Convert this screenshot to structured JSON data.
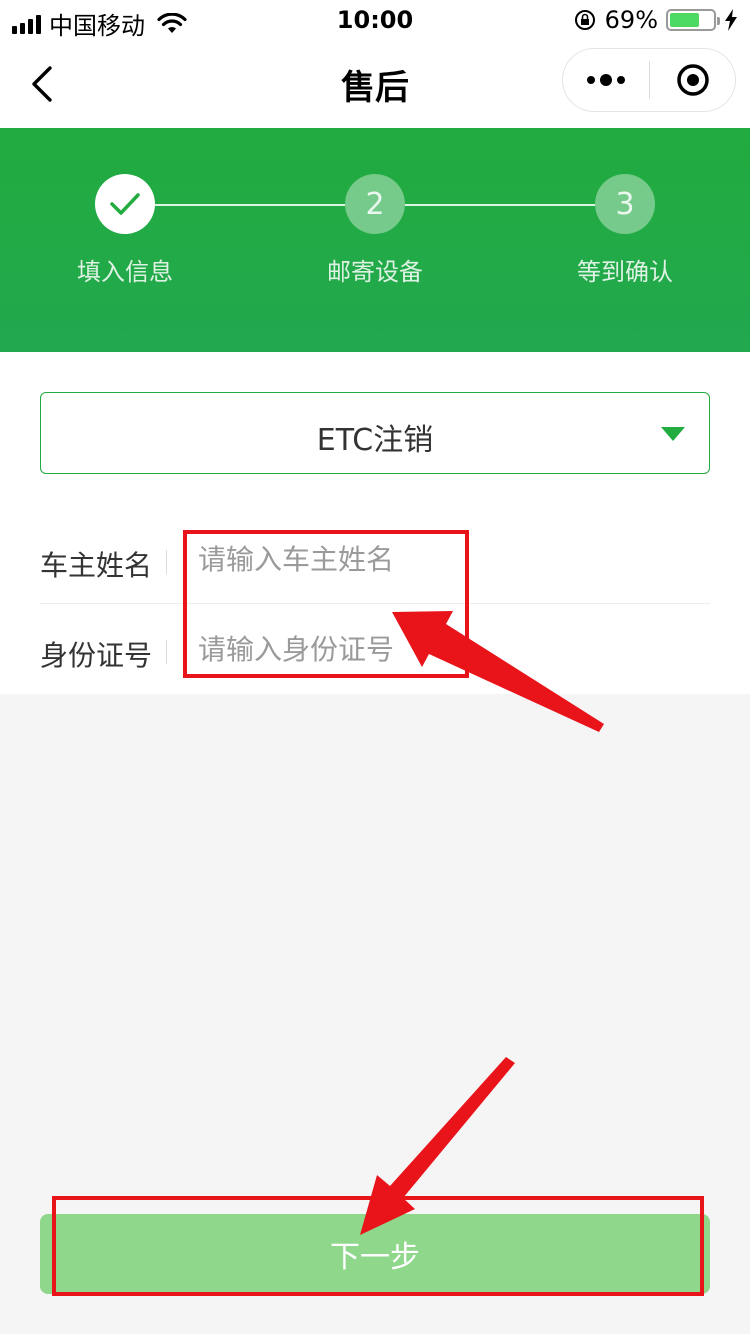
{
  "status_bar": {
    "carrier": "中国移动",
    "time": "10:00",
    "battery_percent": "69%",
    "battery_level": 0.69
  },
  "nav": {
    "title": "售后",
    "icons": [
      "back-arrow-icon",
      "more-dots-icon",
      "target-icon"
    ]
  },
  "steps": [
    {
      "label": "填入信息",
      "status": "done"
    },
    {
      "label": "邮寄设备",
      "number": "2",
      "status": "pending"
    },
    {
      "label": "等到确认",
      "number": "3",
      "status": "pending"
    }
  ],
  "service_type": {
    "value": "ETC注销"
  },
  "form": {
    "owner_name": {
      "label": "车主姓名",
      "placeholder": "请输入车主姓名",
      "value": ""
    },
    "id_number": {
      "label": "身份证号",
      "placeholder": "请输入身份证号",
      "value": ""
    }
  },
  "next_button": {
    "label": "下一步"
  },
  "colors": {
    "brand_green": "#22ab3f",
    "button_green": "#8fd78b",
    "annotation_red": "#e8141a"
  }
}
